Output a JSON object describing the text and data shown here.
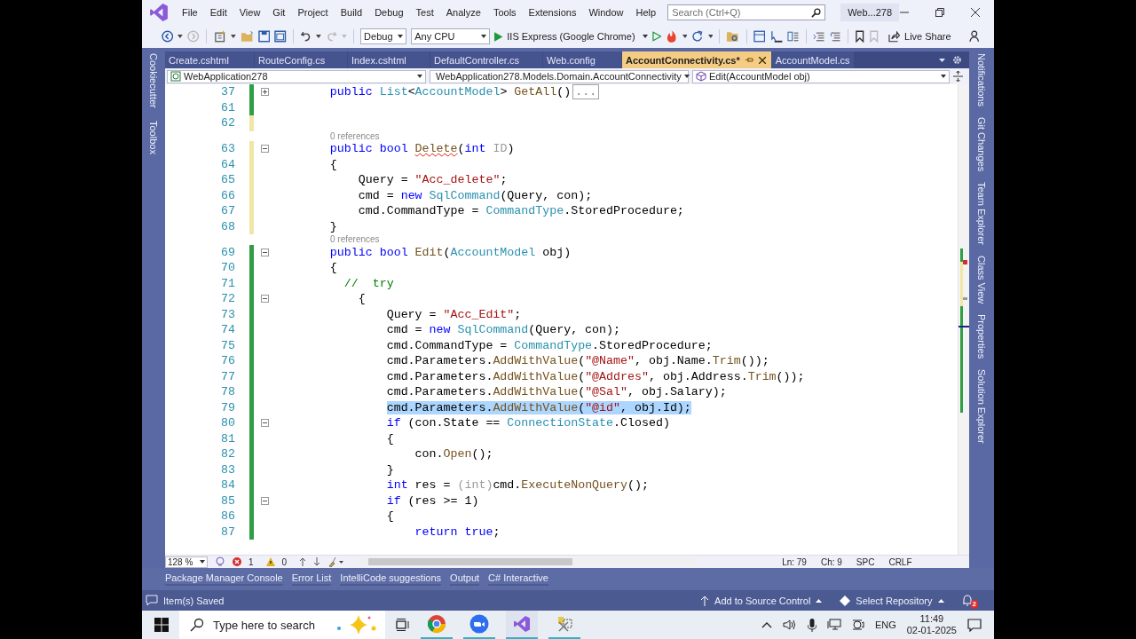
{
  "menu": [
    "File",
    "Edit",
    "View",
    "Git",
    "Project",
    "Build",
    "Debug",
    "Test",
    "Analyze",
    "Tools",
    "Extensions",
    "Window",
    "Help"
  ],
  "search": {
    "placeholder": "Search (Ctrl+Q)"
  },
  "solution_badge": "Web...278",
  "toolbar": {
    "configuration": "Debug",
    "platform": "Any CPU",
    "run_target": "IIS Express (Google Chrome)",
    "live_share": "Live Share"
  },
  "tabs": [
    {
      "label": "Create.cshtml",
      "selected": false
    },
    {
      "label": "RouteConfig.cs",
      "selected": false
    },
    {
      "label": "Index.cshtml",
      "selected": false
    },
    {
      "label": "DefaultController.cs",
      "selected": false
    },
    {
      "label": "Web.config",
      "selected": false
    },
    {
      "label": "AccountConnectivity.cs*",
      "selected": true
    },
    {
      "label": "AccountModel.cs",
      "selected": false
    }
  ],
  "left_panels": [
    "Cookiecutter",
    "Toolbox"
  ],
  "right_panels": [
    "Notifications",
    "Git Changes",
    "Team Explorer",
    "Class View",
    "Properties",
    "Solution Explorer"
  ],
  "navigation": {
    "project": "WebApplication278",
    "type": "WebApplication278.Models.Domain.AccountConnectivity",
    "member": "Edit(AccountModel obj)"
  },
  "code": {
    "lines": [
      {
        "kind": "code",
        "number": "37",
        "saved": true,
        "collapsed": true,
        "selected": false,
        "tokens": [
          {
            "kind": "keyword",
            "text": "        public "
          },
          {
            "kind": "type",
            "text": "List"
          },
          {
            "kind": "plain",
            "text": "<"
          },
          {
            "kind": "type",
            "text": "AccountModel"
          },
          {
            "kind": "plain",
            "text": "> "
          },
          {
            "kind": "method",
            "text": "GetAll"
          },
          {
            "kind": "plain",
            "text": "()"
          },
          {
            "kind": "collapsed",
            "text": "..."
          }
        ]
      },
      {
        "kind": "code",
        "number": "61",
        "saved": true,
        "selected": false
      },
      {
        "kind": "code",
        "number": "62",
        "saved": false,
        "selected": false
      },
      {
        "kind": "codelens",
        "text": "0 references"
      },
      {
        "kind": "code",
        "number": "63",
        "saved": false,
        "collapsed": false,
        "selected": false,
        "tokens": [
          {
            "kind": "keyword",
            "text": "        public "
          },
          {
            "kind": "keyword",
            "text": "bool "
          },
          {
            "kind": "method-error",
            "text": "Delete"
          },
          {
            "kind": "plain",
            "text": "("
          },
          {
            "kind": "keyword",
            "text": "int "
          },
          {
            "kind": "faded",
            "text": "ID"
          },
          {
            "kind": "plain",
            "text": ")"
          }
        ]
      },
      {
        "kind": "code",
        "number": "64",
        "saved": false,
        "selected": false,
        "tokens": [
          {
            "kind": "plain",
            "text": "        {"
          }
        ]
      },
      {
        "kind": "code",
        "number": "65",
        "saved": false,
        "selected": false,
        "tokens": [
          {
            "kind": "plain",
            "text": "            Query = "
          },
          {
            "kind": "string",
            "text": "\"Acc_delete\""
          },
          {
            "kind": "plain",
            "text": ";"
          }
        ]
      },
      {
        "kind": "code",
        "number": "66",
        "saved": false,
        "selected": false,
        "tokens": [
          {
            "kind": "plain",
            "text": "            cmd = "
          },
          {
            "kind": "keyword",
            "text": "new "
          },
          {
            "kind": "type",
            "text": "SqlCommand"
          },
          {
            "kind": "plain",
            "text": "(Query, con);"
          }
        ]
      },
      {
        "kind": "code",
        "number": "67",
        "saved": false,
        "selected": false,
        "tokens": [
          {
            "kind": "plain",
            "text": "            cmd.CommandType = "
          },
          {
            "kind": "type",
            "text": "CommandType"
          },
          {
            "kind": "plain",
            "text": ".StoredProcedure;"
          }
        ]
      },
      {
        "kind": "code",
        "number": "68",
        "saved": false,
        "selected": false,
        "tokens": [
          {
            "kind": "plain",
            "text": "        }"
          }
        ]
      },
      {
        "kind": "codelens",
        "text": "0 references"
      },
      {
        "kind": "code",
        "number": "69",
        "saved": true,
        "collapsed": false,
        "selected": false,
        "tokens": [
          {
            "kind": "keyword",
            "text": "        public "
          },
          {
            "kind": "keyword",
            "text": "bool "
          },
          {
            "kind": "method",
            "text": "Edit"
          },
          {
            "kind": "plain",
            "text": "("
          },
          {
            "kind": "type",
            "text": "AccountModel"
          },
          {
            "kind": "plain",
            "text": " obj)"
          }
        ]
      },
      {
        "kind": "code",
        "number": "70",
        "saved": true,
        "selected": false,
        "tokens": [
          {
            "kind": "plain",
            "text": "        {"
          }
        ]
      },
      {
        "kind": "code",
        "number": "71",
        "saved": true,
        "selected": false,
        "tokens": [
          {
            "kind": "comment",
            "text": "          //  try"
          }
        ]
      },
      {
        "kind": "code",
        "number": "72",
        "saved": true,
        "collapsed": false,
        "selected": false,
        "tokens": [
          {
            "kind": "plain",
            "text": "            {"
          }
        ]
      },
      {
        "kind": "code",
        "number": "73",
        "saved": true,
        "selected": false,
        "tokens": [
          {
            "kind": "plain",
            "text": "                Query = "
          },
          {
            "kind": "string",
            "text": "\"Acc_Edit\""
          },
          {
            "kind": "plain",
            "text": ";"
          }
        ]
      },
      {
        "kind": "code",
        "number": "74",
        "saved": true,
        "selected": false,
        "tokens": [
          {
            "kind": "plain",
            "text": "                cmd = "
          },
          {
            "kind": "keyword",
            "text": "new "
          },
          {
            "kind": "type",
            "text": "SqlCommand"
          },
          {
            "kind": "plain",
            "text": "(Query, con);"
          }
        ]
      },
      {
        "kind": "code",
        "number": "75",
        "saved": true,
        "selected": false,
        "tokens": [
          {
            "kind": "plain",
            "text": "                cmd.CommandType = "
          },
          {
            "kind": "type",
            "text": "CommandType"
          },
          {
            "kind": "plain",
            "text": ".StoredProcedure;"
          }
        ]
      },
      {
        "kind": "code",
        "number": "76",
        "saved": true,
        "selected": false,
        "tokens": [
          {
            "kind": "plain",
            "text": "                cmd.Parameters."
          },
          {
            "kind": "method",
            "text": "AddWithValue"
          },
          {
            "kind": "plain",
            "text": "("
          },
          {
            "kind": "string",
            "text": "\"@Name\""
          },
          {
            "kind": "plain",
            "text": ", obj.Name."
          },
          {
            "kind": "method",
            "text": "Trim"
          },
          {
            "kind": "plain",
            "text": "());"
          }
        ]
      },
      {
        "kind": "code",
        "number": "77",
        "saved": true,
        "selected": false,
        "tokens": [
          {
            "kind": "plain",
            "text": "                cmd.Parameters."
          },
          {
            "kind": "method",
            "text": "AddWithValue"
          },
          {
            "kind": "plain",
            "text": "("
          },
          {
            "kind": "string",
            "text": "\"@Addres\""
          },
          {
            "kind": "plain",
            "text": ", obj.Address."
          },
          {
            "kind": "method",
            "text": "Trim"
          },
          {
            "kind": "plain",
            "text": "());"
          }
        ]
      },
      {
        "kind": "code",
        "number": "78",
        "saved": true,
        "selected": false,
        "tokens": [
          {
            "kind": "plain",
            "text": "                cmd.Parameters."
          },
          {
            "kind": "method",
            "text": "AddWithValue"
          },
          {
            "kind": "plain",
            "text": "("
          },
          {
            "kind": "string",
            "text": "\"@Sal\""
          },
          {
            "kind": "plain",
            "text": ", obj.Salary);"
          }
        ]
      },
      {
        "kind": "code",
        "number": "79",
        "saved": true,
        "selected": true,
        "tokens": [
          {
            "kind": "plain",
            "text": "                cmd.Parameters."
          },
          {
            "kind": "method",
            "text": "AddWithValue"
          },
          {
            "kind": "plain",
            "text": "("
          },
          {
            "kind": "string",
            "text": "\"@id\""
          },
          {
            "kind": "plain",
            "text": ", obj.Id);"
          }
        ]
      },
      {
        "kind": "code",
        "number": "80",
        "saved": true,
        "collapsed": false,
        "selected": false,
        "tokens": [
          {
            "kind": "keyword",
            "text": "                if"
          },
          {
            "kind": "plain",
            "text": " (con.State == "
          },
          {
            "kind": "type",
            "text": "ConnectionState"
          },
          {
            "kind": "plain",
            "text": ".Closed)"
          }
        ]
      },
      {
        "kind": "code",
        "number": "81",
        "saved": true,
        "selected": false,
        "tokens": [
          {
            "kind": "plain",
            "text": "                {"
          }
        ]
      },
      {
        "kind": "code",
        "number": "82",
        "saved": true,
        "selected": false,
        "tokens": [
          {
            "kind": "plain",
            "text": "                    con."
          },
          {
            "kind": "method",
            "text": "Open"
          },
          {
            "kind": "plain",
            "text": "();"
          }
        ]
      },
      {
        "kind": "code",
        "number": "83",
        "saved": true,
        "selected": false,
        "tokens": [
          {
            "kind": "plain",
            "text": "                }"
          }
        ]
      },
      {
        "kind": "code",
        "number": "84",
        "saved": true,
        "selected": false,
        "tokens": [
          {
            "kind": "keyword",
            "text": "                int"
          },
          {
            "kind": "plain",
            "text": " res = "
          },
          {
            "kind": "faded",
            "text": "(int)"
          },
          {
            "kind": "plain",
            "text": "cmd."
          },
          {
            "kind": "method",
            "text": "ExecuteNonQuery"
          },
          {
            "kind": "plain",
            "text": "();"
          }
        ]
      },
      {
        "kind": "code",
        "number": "85",
        "saved": true,
        "collapsed": false,
        "selected": false,
        "tokens": [
          {
            "kind": "keyword",
            "text": "                if"
          },
          {
            "kind": "plain",
            "text": " (res >= 1)"
          }
        ]
      },
      {
        "kind": "code",
        "number": "86",
        "saved": true,
        "selected": false,
        "tokens": [
          {
            "kind": "plain",
            "text": "                {"
          }
        ]
      },
      {
        "kind": "code",
        "number": "87",
        "saved": true,
        "selected": false,
        "tokens": [
          {
            "kind": "keyword",
            "text": "                    return "
          },
          {
            "kind": "keyword",
            "text": "true"
          },
          {
            "kind": "plain",
            "text": ";"
          }
        ]
      }
    ]
  },
  "editor_status": {
    "zoom": "128 %",
    "errors": "1",
    "warnings": "0",
    "line": "Ln: 79",
    "column": "Ch: 9",
    "whitespace": "SPC",
    "line_endings": "CRLF"
  },
  "tool_tabs": [
    "Package Manager Console",
    "Error List",
    "IntelliCode suggestions",
    "Output",
    "C# Interactive"
  ],
  "status_bar": {
    "message": "Item(s) Saved",
    "source_control": "Add to Source Control",
    "repository": "Select Repository",
    "notifications": "2"
  },
  "taskbar": {
    "search_placeholder": "Type here to search",
    "language": "ENG",
    "time": "11:49",
    "date": "02-01-2025"
  }
}
